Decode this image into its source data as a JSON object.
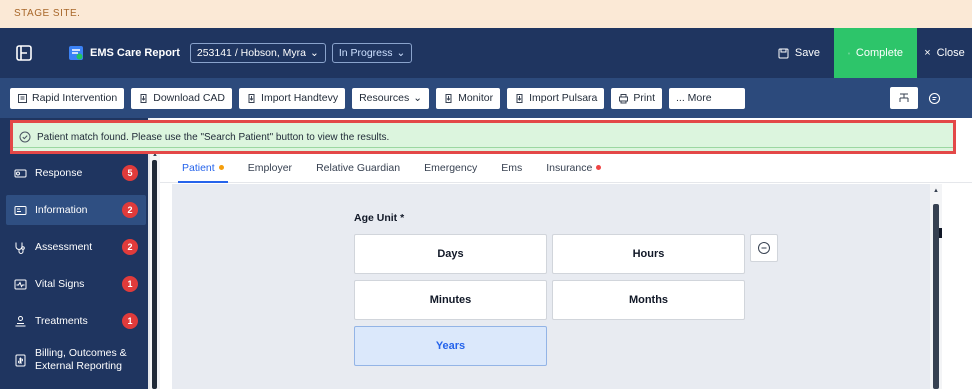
{
  "stage": {
    "text": "STAGE SITE."
  },
  "header": {
    "app_title": "EMS Care Report",
    "patient_selector": "253141 / Hobson, Myra",
    "status_selector": "In Progress",
    "save_label": "Save",
    "complete_label": "Complete",
    "close_label": "Close",
    "complete_color": "#2dc56a",
    "bg_color": "#1f3560"
  },
  "toolbar": {
    "buttons": [
      {
        "label": "Rapid Intervention",
        "icon": "building-icon"
      },
      {
        "label": "Download CAD",
        "icon": "import-icon"
      },
      {
        "label": "Import Handtevy",
        "icon": "import-icon"
      },
      {
        "label": "Resources",
        "icon": "chevron-down-icon"
      },
      {
        "label": "Monitor",
        "icon": "import-icon"
      },
      {
        "label": "Import Pulsara",
        "icon": "import-icon"
      },
      {
        "label": "Print",
        "icon": "printer-icon"
      },
      {
        "label": "... More",
        "icon": ""
      }
    ]
  },
  "banner": {
    "message": "Patient match found. Please use the \"Search Patient\" button to view the results."
  },
  "sidebar": {
    "items": [
      {
        "label": "Response",
        "badge": "5",
        "icon": "response-icon"
      },
      {
        "label": "Information",
        "badge": "2",
        "icon": "id-card-icon",
        "active": true
      },
      {
        "label": "Assessment",
        "badge": "2",
        "icon": "stethoscope-icon"
      },
      {
        "label": "Vital Signs",
        "badge": "1",
        "icon": "heartbeat-icon"
      },
      {
        "label": "Treatments",
        "badge": "1",
        "icon": "treatment-icon"
      },
      {
        "label": "Billing, Outcomes & External Reporting",
        "line1": "Billing, Outcomes &",
        "line2": "External Reporting",
        "badge": "",
        "icon": "billing-icon"
      }
    ]
  },
  "tabs": [
    {
      "label": "Patient",
      "active": true,
      "dot": "orange"
    },
    {
      "label": "Employer",
      "active": false,
      "dot": ""
    },
    {
      "label": "Relative Guardian",
      "active": false,
      "dot": ""
    },
    {
      "label": "Emergency",
      "active": false,
      "dot": ""
    },
    {
      "label": "Ems",
      "active": false,
      "dot": ""
    },
    {
      "label": "Insurance",
      "active": false,
      "dot": "red"
    }
  ],
  "form": {
    "age_unit_label": "Age Unit",
    "required_marker": "*",
    "options": [
      "Days",
      "Hours",
      "Minutes",
      "Months",
      "Years"
    ],
    "selected": "Years"
  }
}
